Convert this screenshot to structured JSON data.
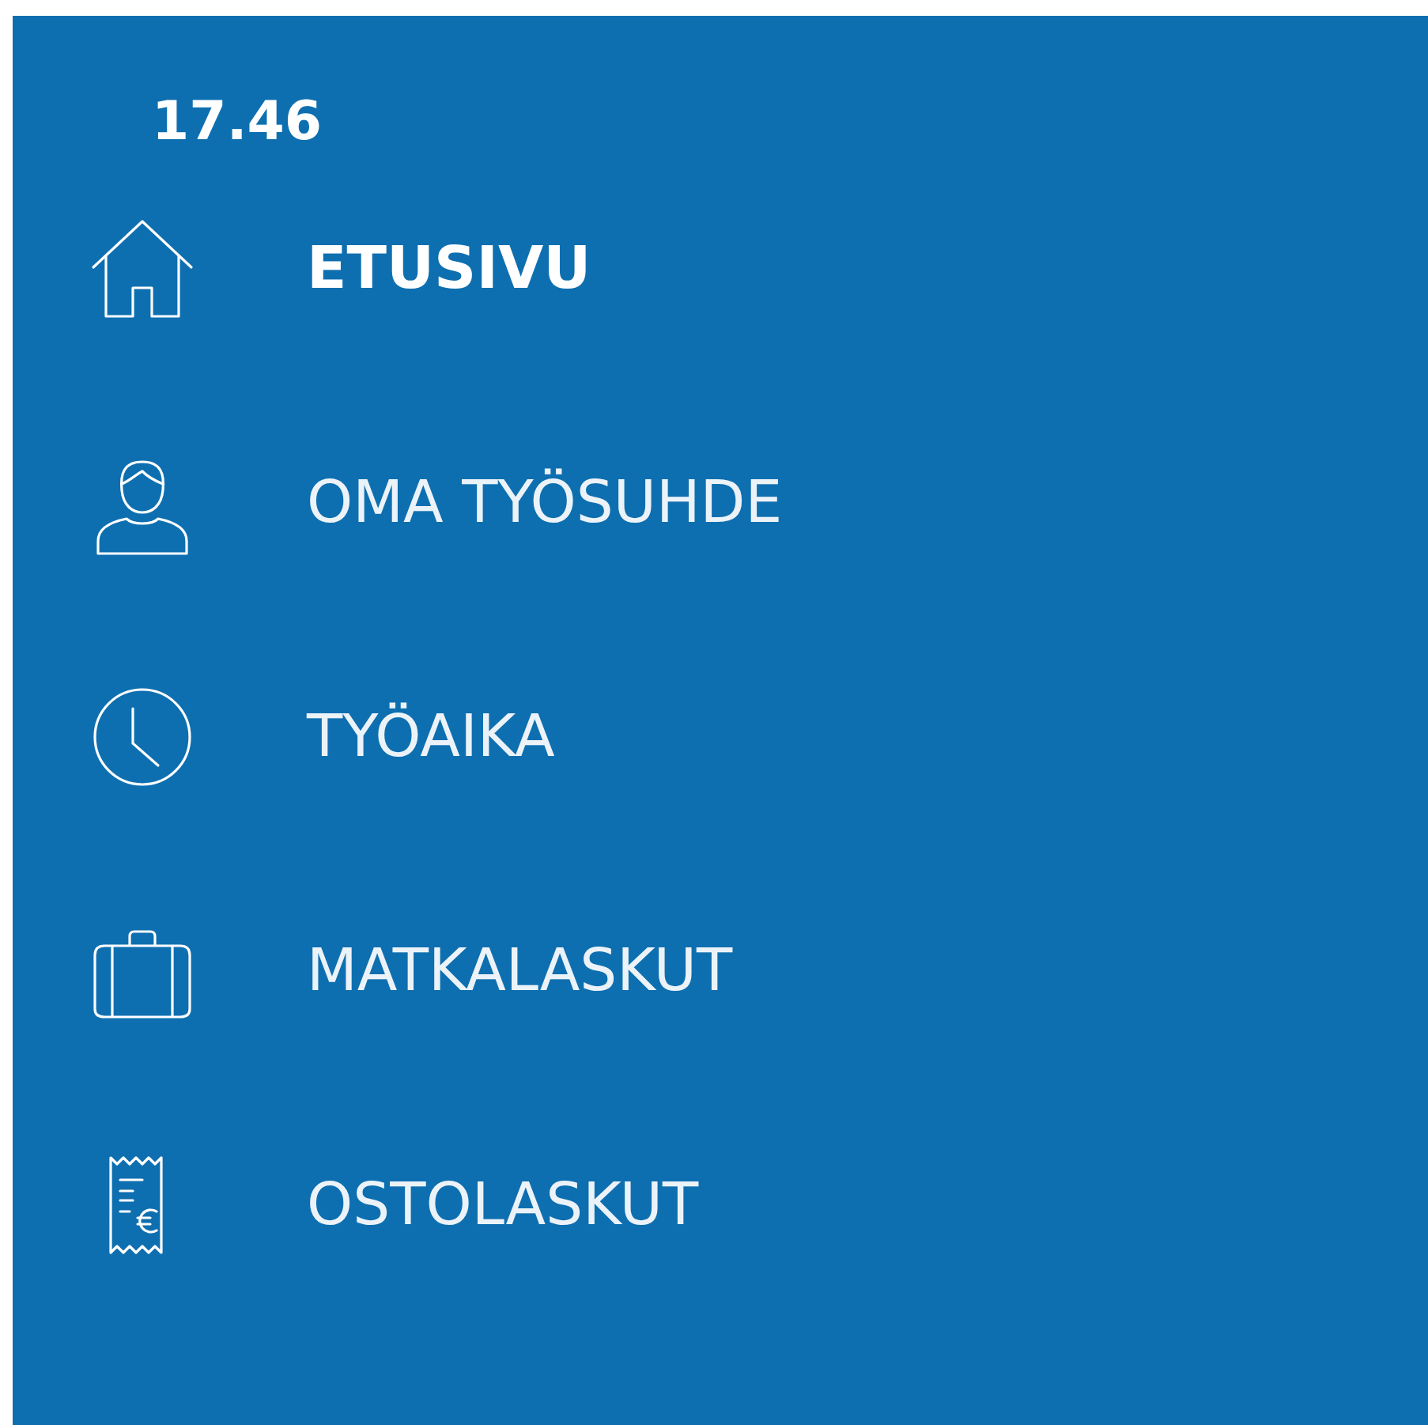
{
  "status_time": "17.46",
  "menu": [
    {
      "label": "ETUSIVU",
      "selected": true
    },
    {
      "label": "OMA TYÖSUHDE",
      "selected": false
    },
    {
      "label": "TYÖAIKA",
      "selected": false
    },
    {
      "label": "MATKALASKUT",
      "selected": false
    },
    {
      "label": "OSTOLASKUT",
      "selected": false
    }
  ]
}
